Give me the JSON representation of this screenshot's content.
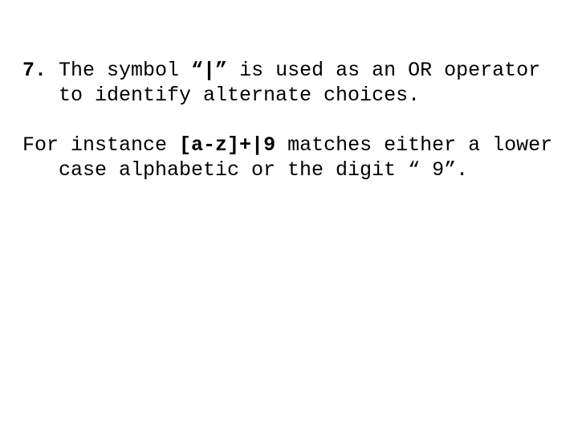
{
  "paragraph1": {
    "num": "7.",
    "t1": " The symbol ",
    "sym": "“|”",
    "t2": "  is used as an OR operator to identify alternate choices."
  },
  "paragraph2": {
    "lead": "For instance ",
    "code": "[a-z]+|9",
    "tail": " matches either a lower case alphabetic or the digit “ 9”."
  }
}
